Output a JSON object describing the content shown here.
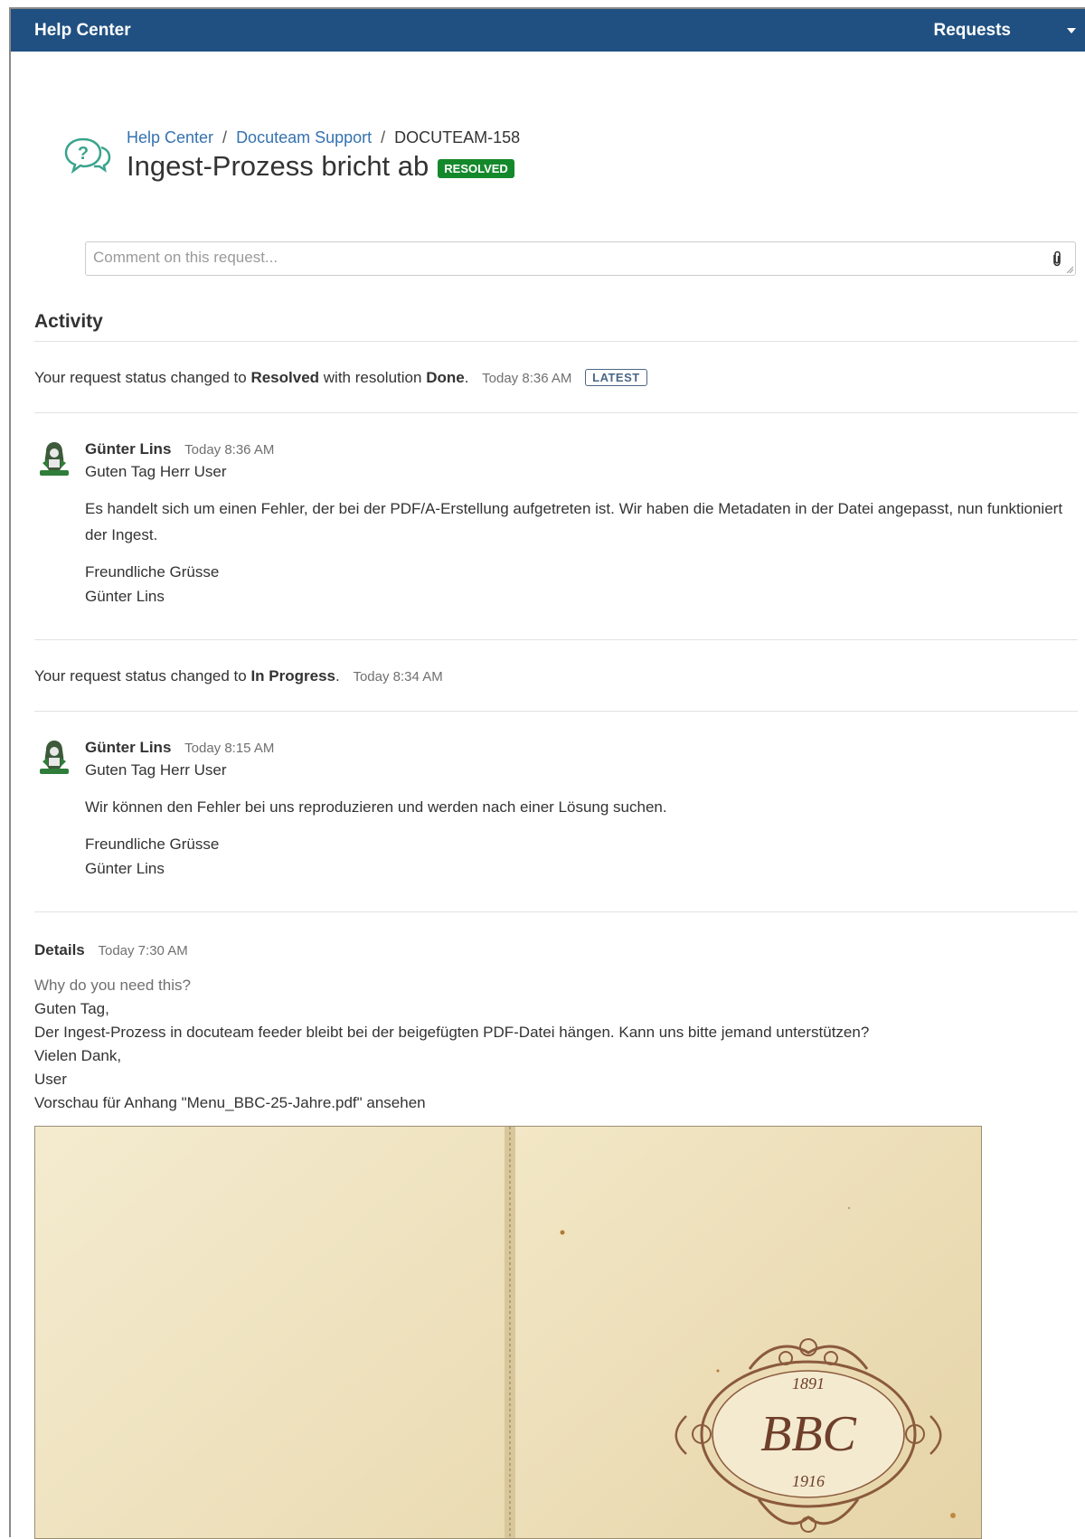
{
  "topbar": {
    "brand": "Help Center",
    "requests": "Requests"
  },
  "header": {
    "breadcrumb": [
      "Help Center",
      "Docuteam Support",
      "DOCUTEAM-158"
    ],
    "title": "Ingest-Prozess bricht ab",
    "status": "RESOLVED",
    "status_color": "#14892c"
  },
  "comment_box": {
    "placeholder": "Comment on this request..."
  },
  "activity": {
    "heading": "Activity",
    "status_change_1": {
      "prefix": "Your request status changed to",
      "status": "Resolved",
      "middle": "with resolution",
      "resolution": "Done",
      "suffix": ".",
      "time": "Today 8:36 AM",
      "badge": "LATEST"
    },
    "comment_1": {
      "author": "Günter Lins",
      "time": "Today 8:36 AM",
      "greeting": "Guten Tag Herr User",
      "body": "Es handelt sich um einen Fehler, der bei der PDF/A-Erstellung aufgetreten ist. Wir haben die Metadaten in der Datei angepasst, nun funktioniert der Ingest.",
      "closing": "Freundliche Grüsse",
      "signature": "Günter Lins"
    },
    "status_change_2": {
      "prefix": "Your request status changed to",
      "status": "In Progress",
      "suffix": ".",
      "time": "Today 8:34 AM"
    },
    "comment_2": {
      "author": "Günter Lins",
      "time": "Today 8:15 AM",
      "greeting": "Guten Tag Herr User",
      "body": "Wir können den Fehler bei uns reproduzieren und werden nach einer Lösung suchen.",
      "closing": "Freundliche Grüsse",
      "signature": "Günter Lins"
    }
  },
  "details": {
    "heading": "Details",
    "time": "Today 7:30 AM",
    "question": "Why do you need this?",
    "lines": [
      "Guten Tag,",
      "Der Ingest-Prozess in docuteam feeder bleibt bei der beigefügten PDF-Datei hängen. Kann uns bitte jemand unterstützen?",
      "Vielen Dank,",
      "User",
      "Vorschau für Anhang \"Menu_BBC-25-Jahre.pdf\" ansehen"
    ]
  },
  "preview": {
    "year_top": "1891",
    "monogram": "BBC",
    "year_bottom": "1916"
  }
}
